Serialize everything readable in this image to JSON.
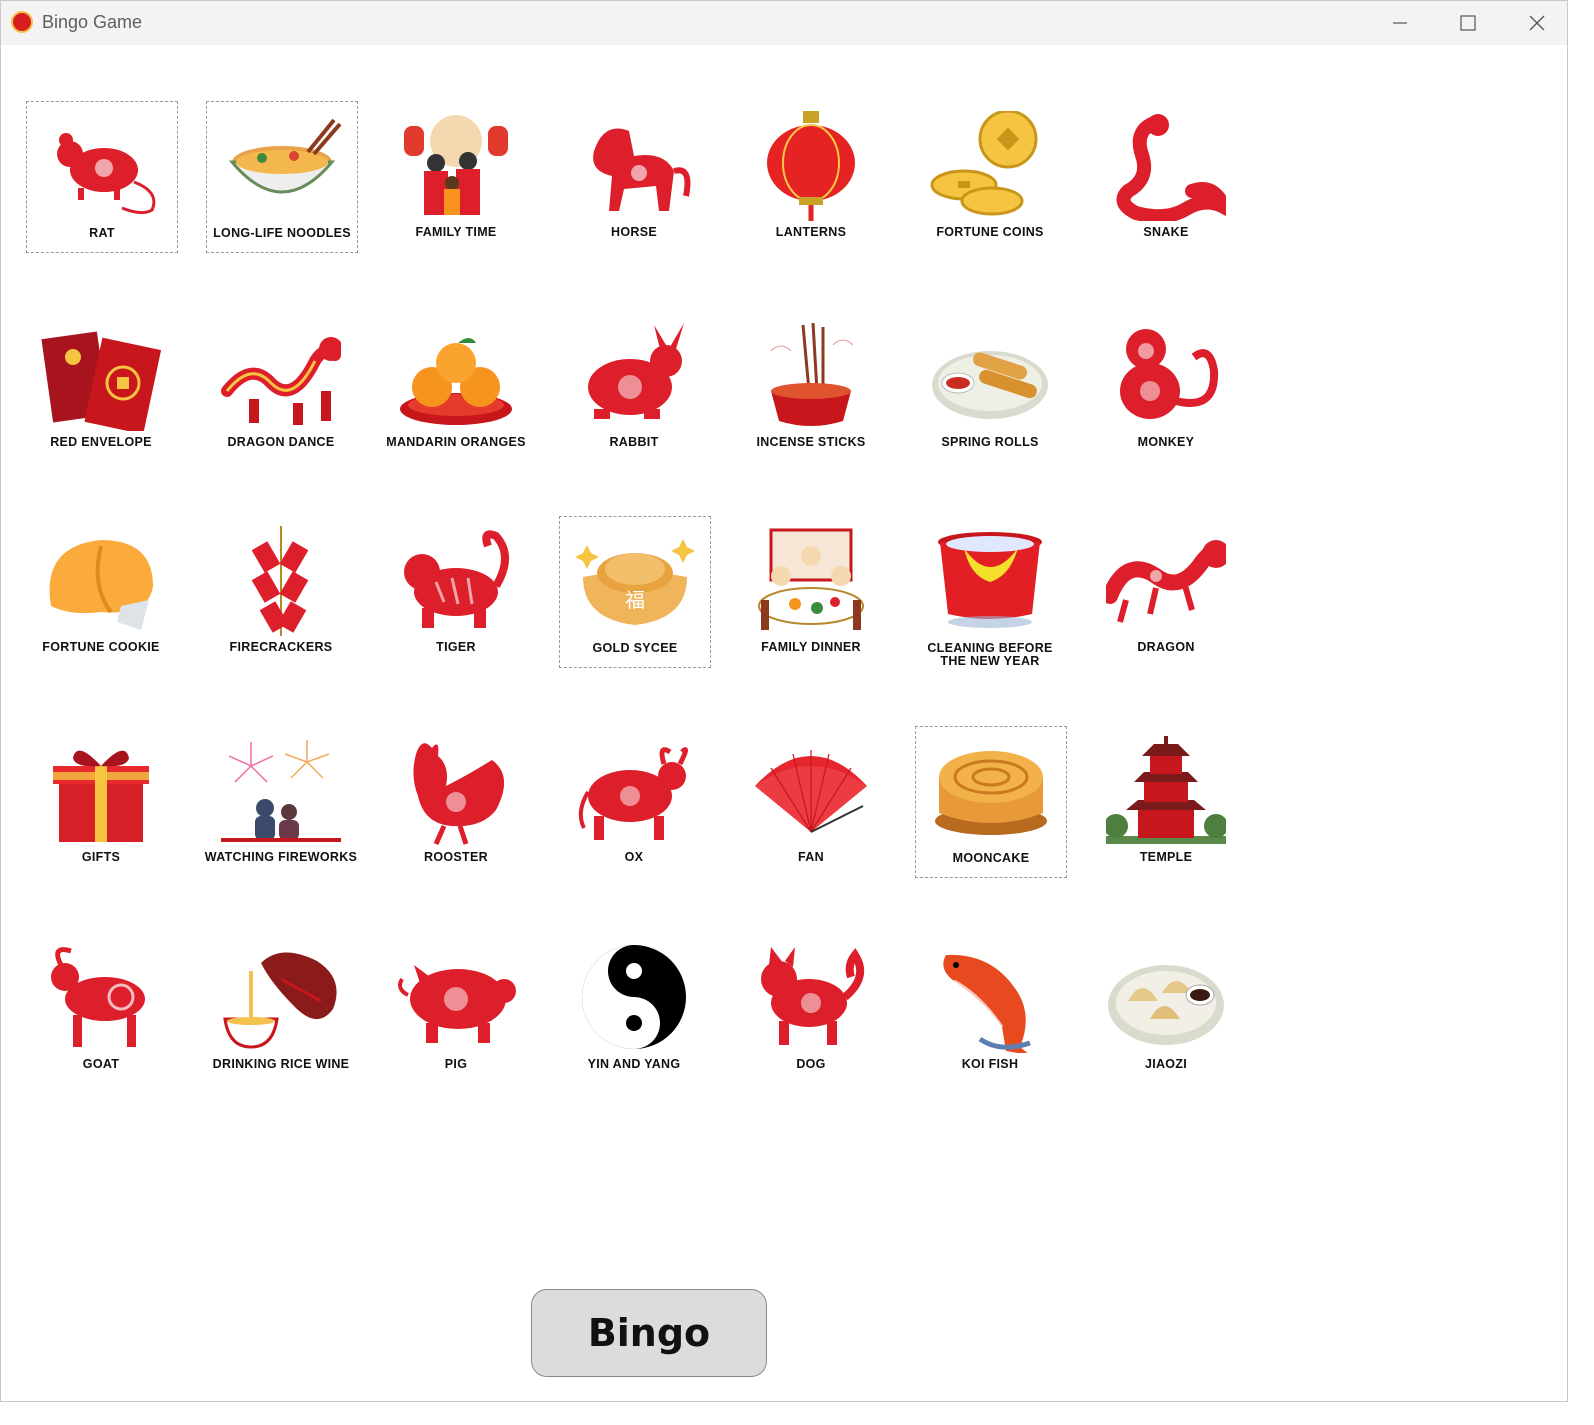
{
  "window": {
    "title": "Bingo Game"
  },
  "colors": {
    "paper_red": "#dd1f2b",
    "gold": "#f5c542",
    "orange": "#f7941d",
    "button_bg": "#dcdcdc"
  },
  "grid": {
    "rows": [
      [
        {
          "label": "RAT",
          "icon": "rat-icon",
          "marked": true
        },
        {
          "label": "LONG-LIFE NOODLES",
          "icon": "noodles-icon",
          "marked": true
        },
        {
          "label": "FAMILY TIME",
          "icon": "family-icon",
          "marked": false
        },
        {
          "label": "HORSE",
          "icon": "horse-icon",
          "marked": false
        },
        {
          "label": "LANTERNS",
          "icon": "lantern-icon",
          "marked": false
        },
        {
          "label": "FORTUNE COINS",
          "icon": "coins-icon",
          "marked": false
        },
        {
          "label": "SNAKE",
          "icon": "snake-icon",
          "marked": false
        }
      ],
      [
        {
          "label": "RED ENVELOPE",
          "icon": "envelope-icon",
          "marked": false
        },
        {
          "label": "DRAGON DANCE",
          "icon": "dragon-dance-icon",
          "marked": false
        },
        {
          "label": "MANDARIN ORANGES",
          "icon": "oranges-icon",
          "marked": false
        },
        {
          "label": "RABBIT",
          "icon": "rabbit-icon",
          "marked": false
        },
        {
          "label": "INCENSE STICKS",
          "icon": "incense-icon",
          "marked": false
        },
        {
          "label": "SPRING ROLLS",
          "icon": "spring-rolls-icon",
          "marked": false
        },
        {
          "label": "MONKEY",
          "icon": "monkey-icon",
          "marked": false
        }
      ],
      [
        {
          "label": "FORTUNE COOKIE",
          "icon": "fortune-cookie-icon",
          "marked": false
        },
        {
          "label": "FIRECRACKERS",
          "icon": "firecrackers-icon",
          "marked": false
        },
        {
          "label": "TIGER",
          "icon": "tiger-icon",
          "marked": false
        },
        {
          "label": "GOLD SYCEE",
          "icon": "sycee-icon",
          "marked": true,
          "sycee_char": "福"
        },
        {
          "label": "FAMILY DINNER",
          "icon": "dinner-icon",
          "marked": false
        },
        {
          "label": "CLEANING BEFORE THE NEW YEAR",
          "icon": "bucket-icon",
          "marked": false
        },
        {
          "label": "DRAGON",
          "icon": "dragon-icon",
          "marked": false
        }
      ],
      [
        {
          "label": "GIFTS",
          "icon": "gift-icon",
          "marked": false
        },
        {
          "label": "WATCHING FIREWORKS",
          "icon": "fireworks-icon",
          "marked": false
        },
        {
          "label": "ROOSTER",
          "icon": "rooster-icon",
          "marked": false
        },
        {
          "label": "OX",
          "icon": "ox-icon",
          "marked": false
        },
        {
          "label": "FAN",
          "icon": "fan-icon",
          "marked": false
        },
        {
          "label": "MOONCAKE",
          "icon": "mooncake-icon",
          "marked": true
        },
        {
          "label": "TEMPLE",
          "icon": "temple-icon",
          "marked": false
        }
      ],
      [
        {
          "label": "GOAT",
          "icon": "goat-icon",
          "marked": false
        },
        {
          "label": "DRINKING RICE WINE",
          "icon": "rice-wine-icon",
          "marked": false
        },
        {
          "label": "PIG",
          "icon": "pig-icon",
          "marked": false
        },
        {
          "label": "YIN AND YANG",
          "icon": "yin-yang-icon",
          "marked": false
        },
        {
          "label": "DOG",
          "icon": "dog-icon",
          "marked": false
        },
        {
          "label": "KOI FISH",
          "icon": "koi-icon",
          "marked": false
        },
        {
          "label": "JIAOZI",
          "icon": "dumplings-icon",
          "marked": false
        }
      ]
    ]
  },
  "bingo_button": {
    "label": "Bingo"
  }
}
